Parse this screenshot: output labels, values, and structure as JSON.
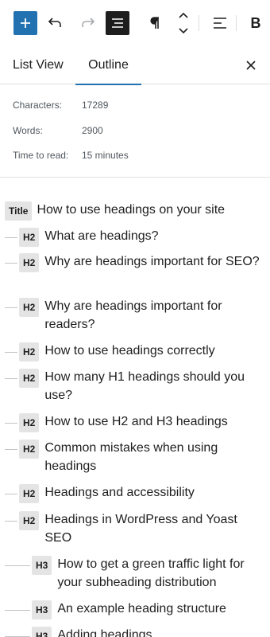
{
  "toolbar": {
    "add_icon": "plus-icon",
    "undo_icon": "undo-icon",
    "redo_icon": "redo-icon",
    "list_view_icon": "list-view-icon",
    "paragraph_icon": "paragraph-icon",
    "mover_icon": "chevron-up-down-icon",
    "align_icon": "align-left-icon",
    "bold_label": "B",
    "accent_color": "#2271b1"
  },
  "tabs": {
    "list_view": "List View",
    "outline": "Outline",
    "close_icon": "close-icon"
  },
  "stats": {
    "characters_label": "Characters:",
    "characters_value": "17289",
    "words_label": "Words:",
    "words_value": "2900",
    "time_label": "Time to read:",
    "time_value": "15 minutes"
  },
  "outline": {
    "items": [
      {
        "level": "Title",
        "text": "How to use headings on your site"
      },
      {
        "level": "H2",
        "text": "What are headings?"
      },
      {
        "level": "H2",
        "text": "Why are headings important for SEO?"
      },
      {
        "level": "H2",
        "text": "Why are headings important for readers?"
      },
      {
        "level": "H2",
        "text": "How to use headings correctly"
      },
      {
        "level": "H2",
        "text": "How many H1 headings should you use?"
      },
      {
        "level": "H2",
        "text": "How to use H2 and H3 headings"
      },
      {
        "level": "H2",
        "text": "Common mistakes when using headings"
      },
      {
        "level": "H2",
        "text": "Headings and accessibility"
      },
      {
        "level": "H2",
        "text": "Headings in WordPress and Yoast SEO"
      },
      {
        "level": "H3",
        "text": "How to get a green traffic light for your subheading distribution"
      },
      {
        "level": "H3",
        "text": "An example heading structure"
      },
      {
        "level": "H3",
        "text": "Adding headings"
      }
    ]
  }
}
